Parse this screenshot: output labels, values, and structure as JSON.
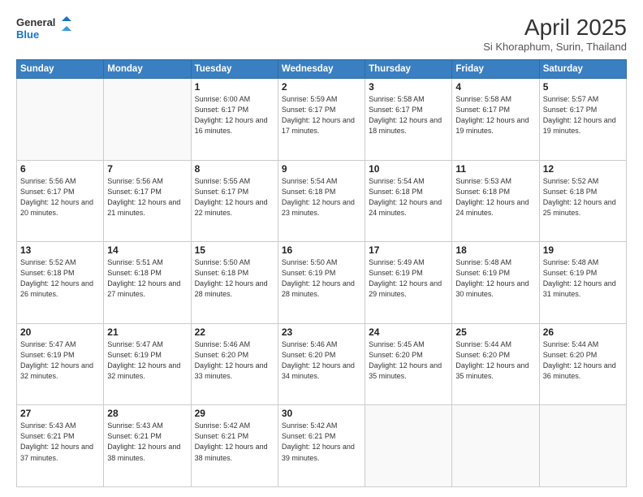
{
  "logo": {
    "general": "General",
    "blue": "Blue"
  },
  "title": "April 2025",
  "subtitle": "Si Khoraphum, Surin, Thailand",
  "days_of_week": [
    "Sunday",
    "Monday",
    "Tuesday",
    "Wednesday",
    "Thursday",
    "Friday",
    "Saturday"
  ],
  "weeks": [
    [
      {
        "day": "",
        "info": ""
      },
      {
        "day": "",
        "info": ""
      },
      {
        "day": "1",
        "info": "Sunrise: 6:00 AM\nSunset: 6:17 PM\nDaylight: 12 hours and 16 minutes."
      },
      {
        "day": "2",
        "info": "Sunrise: 5:59 AM\nSunset: 6:17 PM\nDaylight: 12 hours and 17 minutes."
      },
      {
        "day": "3",
        "info": "Sunrise: 5:58 AM\nSunset: 6:17 PM\nDaylight: 12 hours and 18 minutes."
      },
      {
        "day": "4",
        "info": "Sunrise: 5:58 AM\nSunset: 6:17 PM\nDaylight: 12 hours and 19 minutes."
      },
      {
        "day": "5",
        "info": "Sunrise: 5:57 AM\nSunset: 6:17 PM\nDaylight: 12 hours and 19 minutes."
      }
    ],
    [
      {
        "day": "6",
        "info": "Sunrise: 5:56 AM\nSunset: 6:17 PM\nDaylight: 12 hours and 20 minutes."
      },
      {
        "day": "7",
        "info": "Sunrise: 5:56 AM\nSunset: 6:17 PM\nDaylight: 12 hours and 21 minutes."
      },
      {
        "day": "8",
        "info": "Sunrise: 5:55 AM\nSunset: 6:17 PM\nDaylight: 12 hours and 22 minutes."
      },
      {
        "day": "9",
        "info": "Sunrise: 5:54 AM\nSunset: 6:18 PM\nDaylight: 12 hours and 23 minutes."
      },
      {
        "day": "10",
        "info": "Sunrise: 5:54 AM\nSunset: 6:18 PM\nDaylight: 12 hours and 24 minutes."
      },
      {
        "day": "11",
        "info": "Sunrise: 5:53 AM\nSunset: 6:18 PM\nDaylight: 12 hours and 24 minutes."
      },
      {
        "day": "12",
        "info": "Sunrise: 5:52 AM\nSunset: 6:18 PM\nDaylight: 12 hours and 25 minutes."
      }
    ],
    [
      {
        "day": "13",
        "info": "Sunrise: 5:52 AM\nSunset: 6:18 PM\nDaylight: 12 hours and 26 minutes."
      },
      {
        "day": "14",
        "info": "Sunrise: 5:51 AM\nSunset: 6:18 PM\nDaylight: 12 hours and 27 minutes."
      },
      {
        "day": "15",
        "info": "Sunrise: 5:50 AM\nSunset: 6:18 PM\nDaylight: 12 hours and 28 minutes."
      },
      {
        "day": "16",
        "info": "Sunrise: 5:50 AM\nSunset: 6:19 PM\nDaylight: 12 hours and 28 minutes."
      },
      {
        "day": "17",
        "info": "Sunrise: 5:49 AM\nSunset: 6:19 PM\nDaylight: 12 hours and 29 minutes."
      },
      {
        "day": "18",
        "info": "Sunrise: 5:48 AM\nSunset: 6:19 PM\nDaylight: 12 hours and 30 minutes."
      },
      {
        "day": "19",
        "info": "Sunrise: 5:48 AM\nSunset: 6:19 PM\nDaylight: 12 hours and 31 minutes."
      }
    ],
    [
      {
        "day": "20",
        "info": "Sunrise: 5:47 AM\nSunset: 6:19 PM\nDaylight: 12 hours and 32 minutes."
      },
      {
        "day": "21",
        "info": "Sunrise: 5:47 AM\nSunset: 6:19 PM\nDaylight: 12 hours and 32 minutes."
      },
      {
        "day": "22",
        "info": "Sunrise: 5:46 AM\nSunset: 6:20 PM\nDaylight: 12 hours and 33 minutes."
      },
      {
        "day": "23",
        "info": "Sunrise: 5:46 AM\nSunset: 6:20 PM\nDaylight: 12 hours and 34 minutes."
      },
      {
        "day": "24",
        "info": "Sunrise: 5:45 AM\nSunset: 6:20 PM\nDaylight: 12 hours and 35 minutes."
      },
      {
        "day": "25",
        "info": "Sunrise: 5:44 AM\nSunset: 6:20 PM\nDaylight: 12 hours and 35 minutes."
      },
      {
        "day": "26",
        "info": "Sunrise: 5:44 AM\nSunset: 6:20 PM\nDaylight: 12 hours and 36 minutes."
      }
    ],
    [
      {
        "day": "27",
        "info": "Sunrise: 5:43 AM\nSunset: 6:21 PM\nDaylight: 12 hours and 37 minutes."
      },
      {
        "day": "28",
        "info": "Sunrise: 5:43 AM\nSunset: 6:21 PM\nDaylight: 12 hours and 38 minutes."
      },
      {
        "day": "29",
        "info": "Sunrise: 5:42 AM\nSunset: 6:21 PM\nDaylight: 12 hours and 38 minutes."
      },
      {
        "day": "30",
        "info": "Sunrise: 5:42 AM\nSunset: 6:21 PM\nDaylight: 12 hours and 39 minutes."
      },
      {
        "day": "",
        "info": ""
      },
      {
        "day": "",
        "info": ""
      },
      {
        "day": "",
        "info": ""
      }
    ]
  ]
}
